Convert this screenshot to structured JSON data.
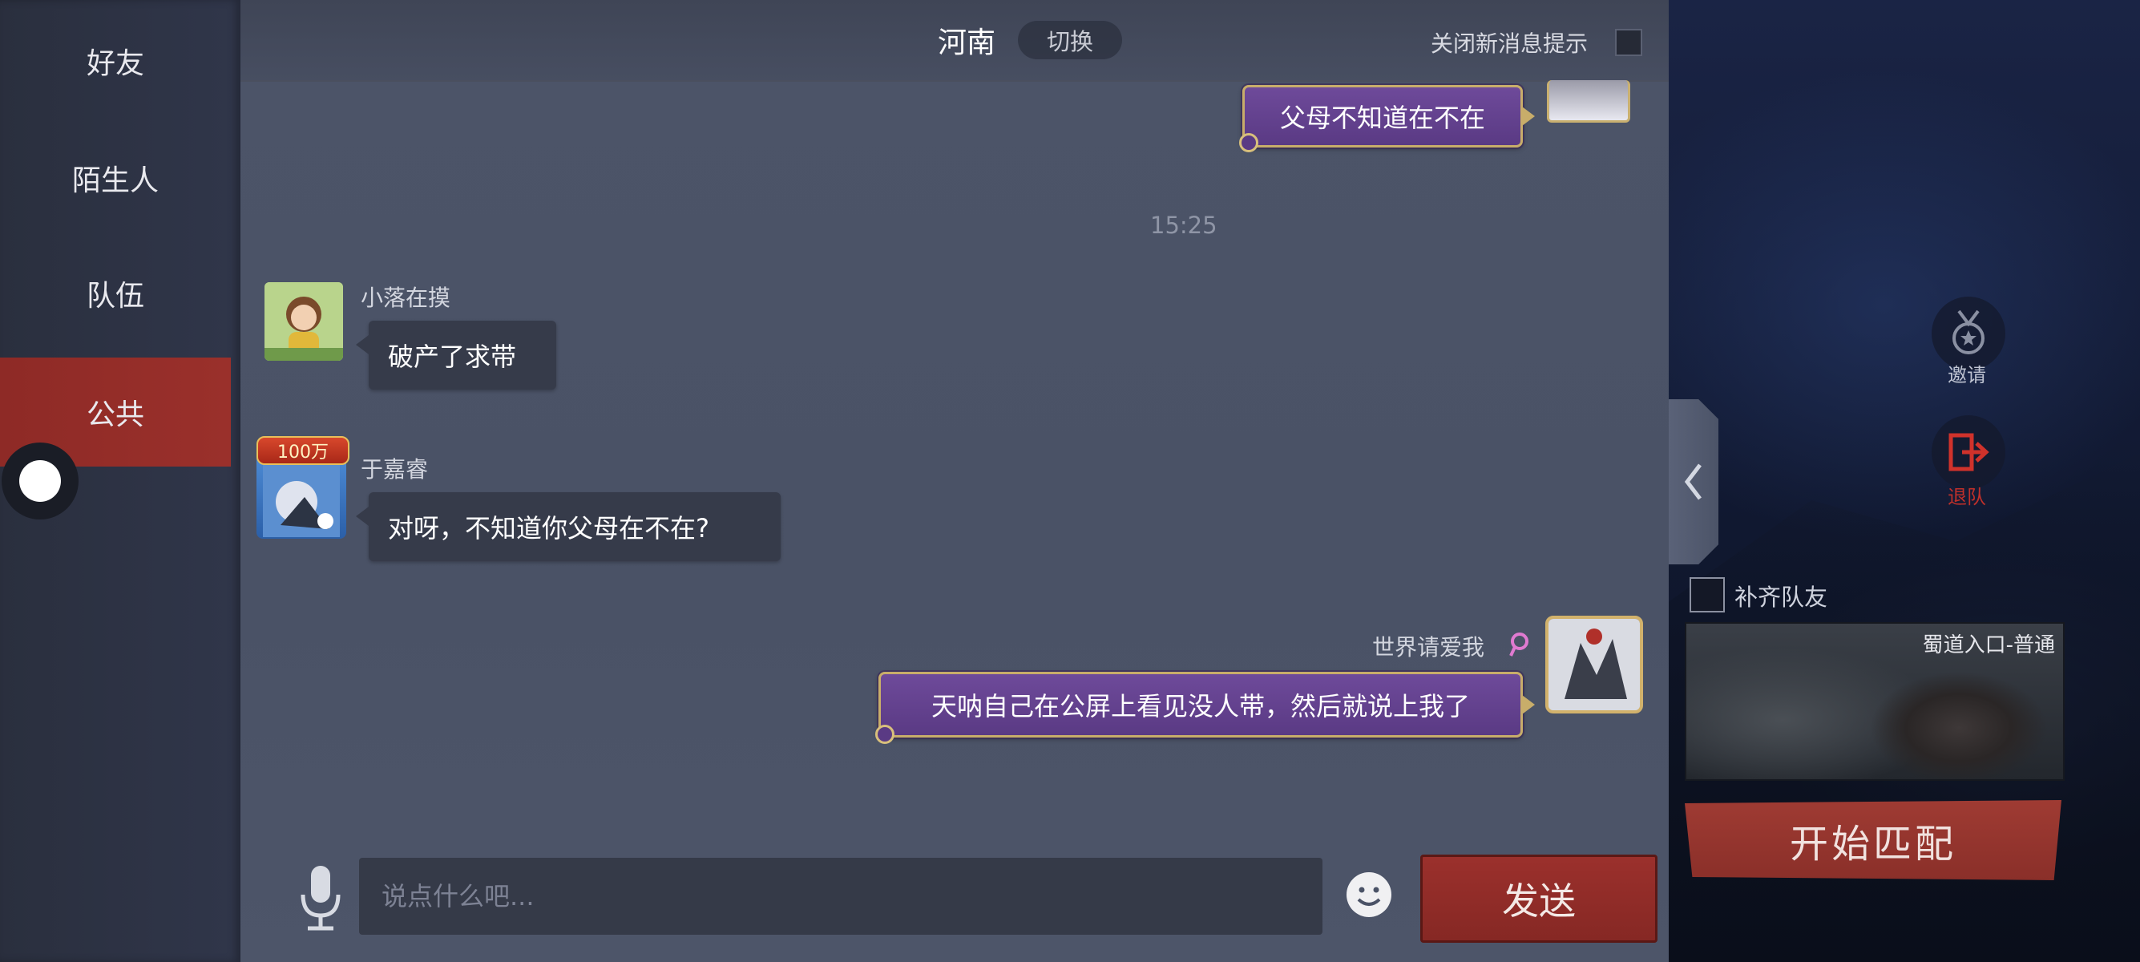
{
  "sidebar": {
    "tabs": [
      {
        "label": "好友"
      },
      {
        "label": "陌生人"
      },
      {
        "label": "队伍"
      },
      {
        "label": "公共"
      }
    ],
    "active_tab": "公共"
  },
  "header": {
    "channel": "河南",
    "switch_label": "切换",
    "mute_label": "关闭新消息提示"
  },
  "chat": {
    "time": "15:25",
    "messages": [
      {
        "side": "right",
        "text": "父母不知道在不在"
      },
      {
        "side": "left",
        "name": "小落在摸",
        "text": "破产了求带"
      },
      {
        "side": "left",
        "name": "于嘉睿",
        "badge": "100万",
        "text": "对呀，不知道你父母在不在?"
      },
      {
        "side": "right",
        "name": "世界请爱我",
        "text": "天呐自己在公屏上看见没人带，然后就说上我了"
      }
    ]
  },
  "input": {
    "placeholder": "说点什么吧...",
    "send_label": "发送"
  },
  "game_ui": {
    "invite_label": "邀请",
    "leave_label": "退队",
    "fill_team_label": "补齐队友",
    "map_name": "蜀道入口-普通",
    "match_label": "开始匹配"
  },
  "colors": {
    "accent_red": "#9a302b",
    "bubble_purple": "#6e4a9a",
    "bubble_gold": "#c8ad6a",
    "leave_red": "#c0302a"
  }
}
